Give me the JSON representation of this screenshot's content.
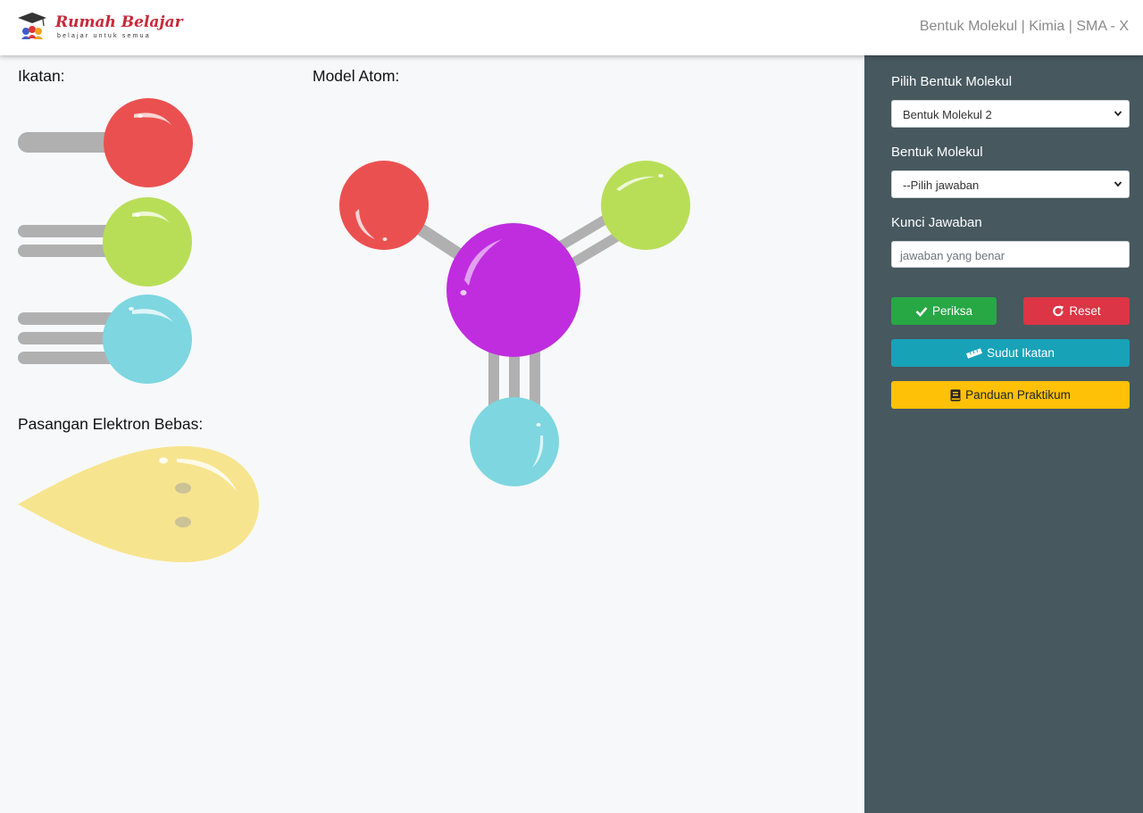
{
  "header": {
    "brand_name": "Rumah Belajar",
    "brand_tagline": "belajar untuk semua",
    "page_title": "Bentuk Molekul | Kimia | SMA - X"
  },
  "workspace": {
    "bonds_label": "Ikatan:",
    "model_label": "Model Atom:",
    "lone_pair_label": "Pasangan Elektron Bebas:"
  },
  "atom_colors": {
    "red": "#eb5050",
    "green": "#b8de58",
    "cyan": "#7ed6e0",
    "purple": "#bf2ddf",
    "lone_pair": "#f7e48e",
    "bond": "#b0b0b0"
  },
  "sidebar": {
    "molecule_select_label": "Pilih Bentuk Molekul",
    "molecule_select_value": "Bentuk Molekul 2",
    "shape_select_label": "Bentuk Molekul",
    "shape_select_value": "--Pilih jawaban",
    "answer_key_label": "Kunci Jawaban",
    "answer_key_placeholder": "jawaban yang benar",
    "check_button": "Periksa",
    "reset_button": "Reset",
    "angle_button": "Sudut Ikatan",
    "guide_button": "Panduan Praktikum"
  }
}
